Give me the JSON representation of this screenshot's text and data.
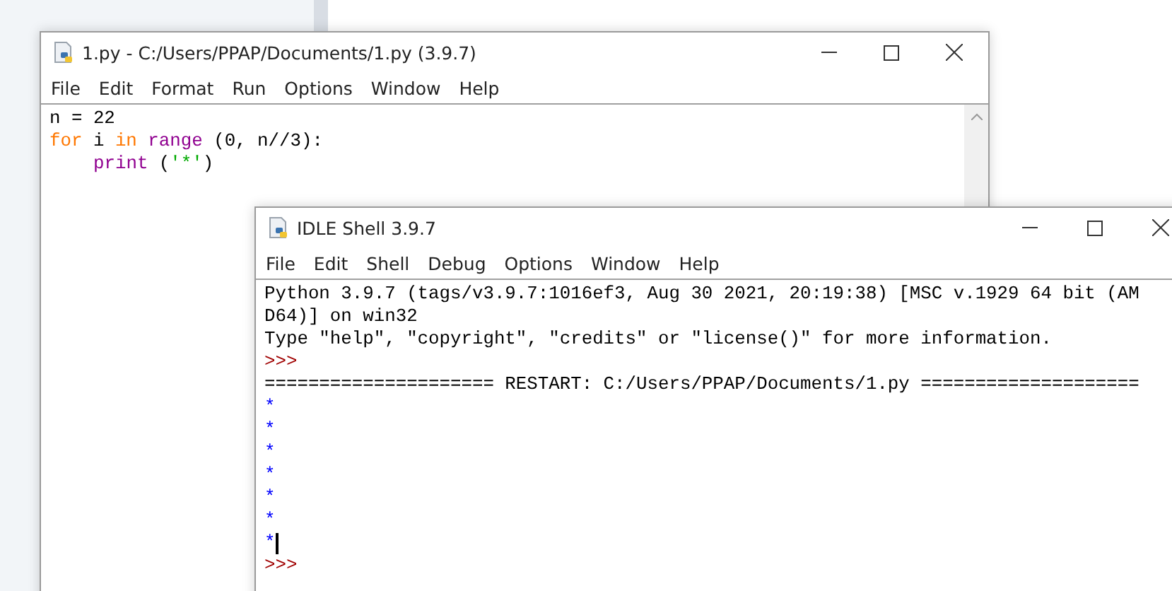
{
  "editor_window": {
    "title": "1.py - C:/Users/PPAP/Documents/1.py (3.9.7)",
    "menu": [
      "File",
      "Edit",
      "Format",
      "Run",
      "Options",
      "Window",
      "Help"
    ],
    "code_lines": [
      {
        "indented": false,
        "tokens": [
          {
            "kind": "plain",
            "text": "n = 22"
          }
        ]
      },
      {
        "indented": false,
        "tokens": [
          {
            "kind": "keyword",
            "text": "for"
          },
          {
            "kind": "plain",
            "text": " i "
          },
          {
            "kind": "keyword",
            "text": "in"
          },
          {
            "kind": "builtin",
            "text": " range"
          },
          {
            "kind": "plain",
            "text": " (0, n//3):"
          }
        ]
      },
      {
        "indented": true,
        "tokens": [
          {
            "kind": "builtin",
            "text": "print"
          },
          {
            "kind": "plain",
            "text": " ("
          },
          {
            "kind": "string",
            "text": "'*'"
          },
          {
            "kind": "plain",
            "text": ")"
          }
        ]
      }
    ]
  },
  "shell_window": {
    "title": "IDLE Shell 3.9.7",
    "menu": [
      "File",
      "Edit",
      "Shell",
      "Debug",
      "Options",
      "Window",
      "Help"
    ],
    "lines": [
      {
        "kind": "plain",
        "text": "Python 3.9.7 (tags/v3.9.7:1016ef3, Aug 30 2021, 20:19:38) [MSC v.1929 64 bit (AM",
        "caret": false
      },
      {
        "kind": "plain",
        "text": "D64)] on win32",
        "caret": false
      },
      {
        "kind": "plain",
        "text": "Type \"help\", \"copyright\", \"credits\" or \"license()\" for more information.",
        "caret": false
      },
      {
        "kind": "prompt",
        "text": ">>>",
        "caret": false
      },
      {
        "kind": "plain",
        "text": "===================== RESTART: C:/Users/PPAP/Documents/1.py ====================",
        "caret": false
      },
      {
        "kind": "stdout",
        "text": "*",
        "caret": false
      },
      {
        "kind": "stdout",
        "text": "*",
        "caret": false
      },
      {
        "kind": "stdout",
        "text": "*",
        "caret": false
      },
      {
        "kind": "stdout",
        "text": "*",
        "caret": false
      },
      {
        "kind": "stdout",
        "text": "*",
        "caret": false
      },
      {
        "kind": "stdout",
        "text": "*",
        "caret": false
      },
      {
        "kind": "stdout",
        "text": "*",
        "caret": true
      },
      {
        "kind": "prompt",
        "text": ">>>",
        "caret": false
      }
    ]
  }
}
